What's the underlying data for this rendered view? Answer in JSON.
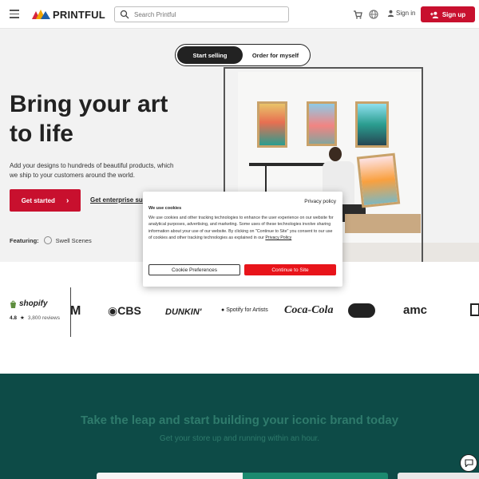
{
  "header": {
    "brand": "PRINTFUL",
    "search_placeholder": "Search Printful",
    "sign_in": "Sign in",
    "sign_up": "Sign up",
    "colors": {
      "accent": "#c8102e"
    }
  },
  "hero": {
    "toggle": {
      "active": "Start selling",
      "other": "Order for myself"
    },
    "title_line1": "Bring your art",
    "title_line2": "to life",
    "subtitle": "Add your designs to hundreds of beautiful products, which we ship to your customers around the world.",
    "cta": "Get started",
    "enterprise_link": "Get enterprise su",
    "featuring_label": "Featuring:",
    "featuring_value": "Swell Scenes"
  },
  "logos": {
    "shopify": "shopify",
    "rating_value": "4.8",
    "rating_reviews": "3,800 reviews",
    "brands": [
      "CBS",
      "DUNKIN'",
      "Spotify for Artists",
      "Coca-Cola",
      "amc"
    ]
  },
  "cookie": {
    "privacy_policy": "Privacy policy",
    "title": "We use cookies",
    "body": "We use cookies and other tracking technologies to enhance the user experience on our website for analytical purposes, advertising, and marketing. Some uses of these technologies involve sharing information about your use of our website. By clicking on \"Continue to Site\" you consent to our use of cookies and other tracking technologies as explained in our",
    "body_link": "Privacy Policy",
    "preferences_button": "Cookie Preferences",
    "continue_button": "Continue to Site"
  },
  "cta_section": {
    "heading": "Take the leap and start building your iconic brand today",
    "subheading": "Get your store up and running within an hour.",
    "colors": {
      "background": "#0d4b47",
      "text": "#2f7b6c"
    }
  }
}
